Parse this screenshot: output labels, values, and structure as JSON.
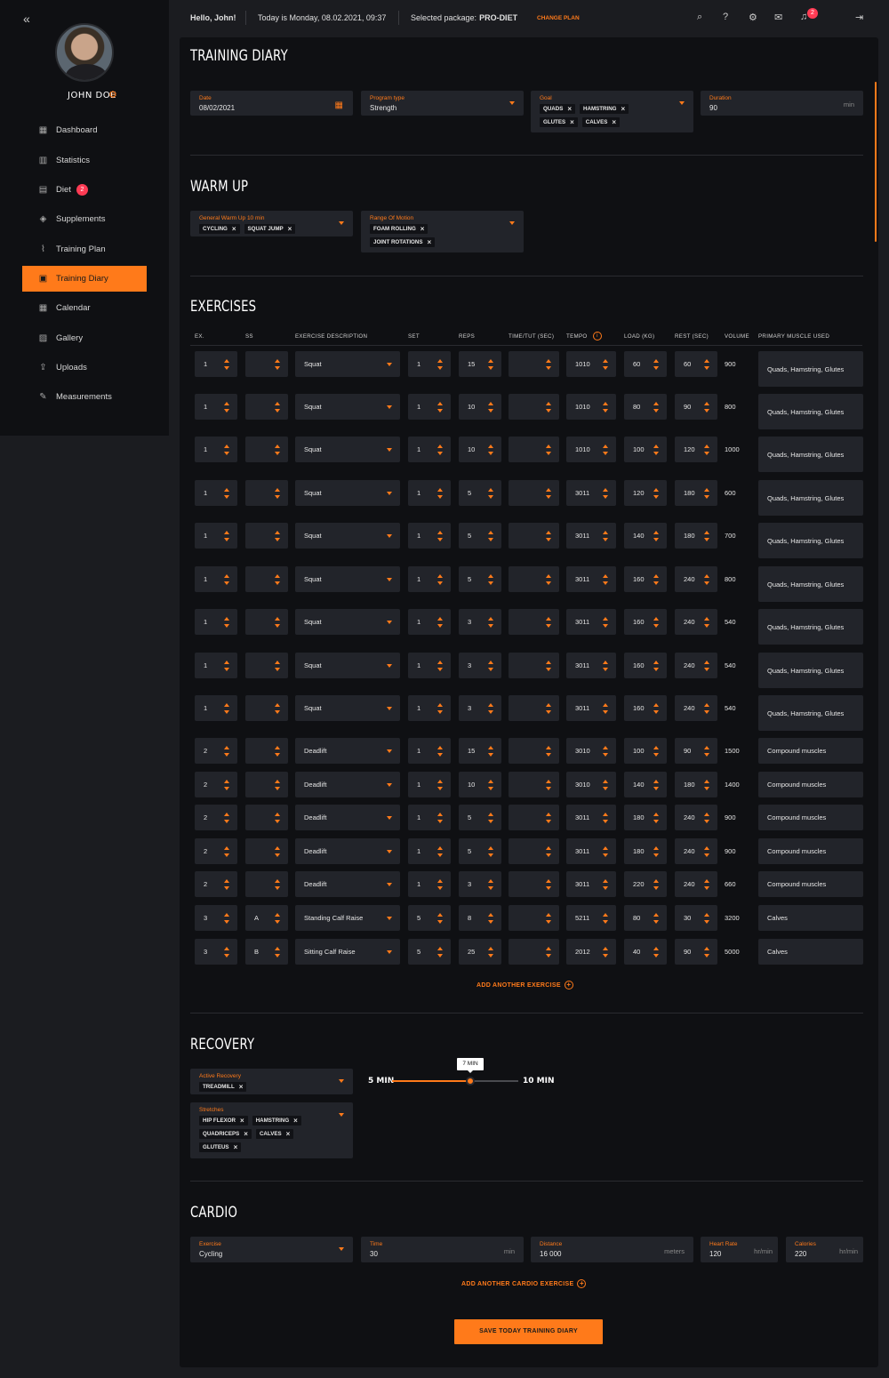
{
  "sidebar": {
    "username": "JOHN DOE",
    "items": [
      {
        "label": "Dashboard",
        "icon": "grid-icon"
      },
      {
        "label": "Statistics",
        "icon": "stats-icon"
      },
      {
        "label": "Diet",
        "icon": "document-icon",
        "badge": "2"
      },
      {
        "label": "Supplements",
        "icon": "pill-icon"
      },
      {
        "label": "Training Plan",
        "icon": "route-icon"
      },
      {
        "label": "Training Diary",
        "icon": "diary-icon",
        "active": true
      },
      {
        "label": "Calendar",
        "icon": "calendar-icon"
      },
      {
        "label": "Gallery",
        "icon": "image-icon"
      },
      {
        "label": "Uploads",
        "icon": "upload-icon"
      },
      {
        "label": "Measurements",
        "icon": "ruler-icon"
      }
    ]
  },
  "topbar": {
    "greeting": "Hello, John!",
    "today": "Today is Monday, 08.02.2021, 09:37",
    "package_label": "Selected package:",
    "package_name": "PRO-DIET",
    "change_plan": "CHANGE PLAN",
    "notifications": "2"
  },
  "page_title": "TRAINING DIARY",
  "top_fields": {
    "date": {
      "label": "Date",
      "value": "08/02/2021"
    },
    "program_type": {
      "label": "Program type",
      "value": "Strength"
    },
    "goal": {
      "label": "Goal",
      "chips": [
        "QUADS",
        "HAMSTRING",
        "GLUTES",
        "CALVES"
      ]
    },
    "duration": {
      "label": "Duration",
      "value": "90",
      "unit": "min"
    }
  },
  "warmup": {
    "title": "WARM UP",
    "general": {
      "label": "General Warm Up 10 min",
      "chips": [
        "CYCLING",
        "SQUAT JUMP"
      ]
    },
    "rom": {
      "label": "Range Of Motion",
      "chips": [
        "FOAM ROLLING",
        "JOINT ROTATIONS"
      ]
    }
  },
  "exercises": {
    "title": "EXERCISES",
    "headers": [
      "EX.",
      "SS",
      "EXERCISE DESCRIPTION",
      "SET",
      "REPS",
      "TIME/TUT (SEC)",
      "TEMPO",
      "LOAD (KG)",
      "REST (SEC)",
      "VOLUME",
      "PRIMARY MUSCLE USED"
    ],
    "rows": [
      {
        "ex": "1",
        "ss": "",
        "desc": "Squat",
        "set": "1",
        "reps": "15",
        "tut": "",
        "tempo": "1010",
        "load": "60",
        "rest": "60",
        "volume": "900",
        "muscle": "Quads, Hamstring, Glutes"
      },
      {
        "ex": "1",
        "ss": "",
        "desc": "Squat",
        "set": "1",
        "reps": "10",
        "tut": "",
        "tempo": "1010",
        "load": "80",
        "rest": "90",
        "volume": "800",
        "muscle": "Quads, Hamstring, Glutes"
      },
      {
        "ex": "1",
        "ss": "",
        "desc": "Squat",
        "set": "1",
        "reps": "10",
        "tut": "",
        "tempo": "1010",
        "load": "100",
        "rest": "120",
        "volume": "1000",
        "muscle": "Quads, Hamstring, Glutes"
      },
      {
        "ex": "1",
        "ss": "",
        "desc": "Squat",
        "set": "1",
        "reps": "5",
        "tut": "",
        "tempo": "3011",
        "load": "120",
        "rest": "180",
        "volume": "600",
        "muscle": "Quads, Hamstring, Glutes"
      },
      {
        "ex": "1",
        "ss": "",
        "desc": "Squat",
        "set": "1",
        "reps": "5",
        "tut": "",
        "tempo": "3011",
        "load": "140",
        "rest": "180",
        "volume": "700",
        "muscle": "Quads, Hamstring, Glutes"
      },
      {
        "ex": "1",
        "ss": "",
        "desc": "Squat",
        "set": "1",
        "reps": "5",
        "tut": "",
        "tempo": "3011",
        "load": "160",
        "rest": "240",
        "volume": "800",
        "muscle": "Quads, Hamstring, Glutes"
      },
      {
        "ex": "1",
        "ss": "",
        "desc": "Squat",
        "set": "1",
        "reps": "3",
        "tut": "",
        "tempo": "3011",
        "load": "160",
        "rest": "240",
        "volume": "540",
        "muscle": "Quads, Hamstring, Glutes"
      },
      {
        "ex": "1",
        "ss": "",
        "desc": "Squat",
        "set": "1",
        "reps": "3",
        "tut": "",
        "tempo": "3011",
        "load": "160",
        "rest": "240",
        "volume": "540",
        "muscle": "Quads, Hamstring, Glutes"
      },
      {
        "ex": "1",
        "ss": "",
        "desc": "Squat",
        "set": "1",
        "reps": "3",
        "tut": "",
        "tempo": "3011",
        "load": "160",
        "rest": "240",
        "volume": "540",
        "muscle": "Quads, Hamstring, Glutes"
      },
      {
        "ex": "2",
        "ss": "",
        "desc": "Deadlift",
        "set": "1",
        "reps": "15",
        "tut": "",
        "tempo": "3010",
        "load": "100",
        "rest": "90",
        "volume": "1500",
        "muscle": "Compound muscles"
      },
      {
        "ex": "2",
        "ss": "",
        "desc": "Deadlift",
        "set": "1",
        "reps": "10",
        "tut": "",
        "tempo": "3010",
        "load": "140",
        "rest": "180",
        "volume": "1400",
        "muscle": "Compound muscles"
      },
      {
        "ex": "2",
        "ss": "",
        "desc": "Deadlift",
        "set": "1",
        "reps": "5",
        "tut": "",
        "tempo": "3011",
        "load": "180",
        "rest": "240",
        "volume": "900",
        "muscle": "Compound muscles"
      },
      {
        "ex": "2",
        "ss": "",
        "desc": "Deadlift",
        "set": "1",
        "reps": "5",
        "tut": "",
        "tempo": "3011",
        "load": "180",
        "rest": "240",
        "volume": "900",
        "muscle": "Compound muscles"
      },
      {
        "ex": "2",
        "ss": "",
        "desc": "Deadlift",
        "set": "1",
        "reps": "3",
        "tut": "",
        "tempo": "3011",
        "load": "220",
        "rest": "240",
        "volume": "660",
        "muscle": "Compound muscles"
      },
      {
        "ex": "3",
        "ss": "A",
        "desc": "Standing Calf Raise",
        "set": "5",
        "reps": "8",
        "tut": "",
        "tempo": "5211",
        "load": "80",
        "rest": "30",
        "volume": "3200",
        "muscle": "Calves"
      },
      {
        "ex": "3",
        "ss": "B",
        "desc": "Sitting Calf Raise",
        "set": "5",
        "reps": "25",
        "tut": "",
        "tempo": "2012",
        "load": "40",
        "rest": "90",
        "volume": "5000",
        "muscle": "Calves"
      }
    ],
    "add_label": "ADD ANOTHER EXERCISE"
  },
  "recovery": {
    "title": "RECOVERY",
    "active": {
      "label": "Active Recovery",
      "chips": [
        "TREADMILL"
      ]
    },
    "stretches": {
      "label": "Stretches",
      "chips": [
        "HIP FLEXOR",
        "HAMSTRING",
        "QUADRICEPS",
        "CALVES",
        "GLUTEUS"
      ]
    },
    "slider": {
      "min_label": "5 MIN",
      "max_label": "10 MIN",
      "value_label": "7 MIN",
      "fraction": 0.62
    }
  },
  "cardio": {
    "title": "CARDIO",
    "exercise": {
      "label": "Exercise",
      "value": "Cycling"
    },
    "time": {
      "label": "Time",
      "value": "30",
      "unit": "min"
    },
    "distance": {
      "label": "Distance",
      "value": "16 000",
      "unit": "meters"
    },
    "heart_rate": {
      "label": "Heart Rate",
      "value": "120",
      "unit": "hr/min"
    },
    "calories": {
      "label": "Calories",
      "value": "220",
      "unit": "hr/min"
    },
    "add_label": "ADD ANOTHER CARDIO EXERCISE"
  },
  "save_label": "SAVE TODAY TRAINING DIARY",
  "colors": {
    "accent": "#ff7a1a",
    "badge": "#ff3b54",
    "panel": "#0f1013",
    "field": "#22242a"
  }
}
